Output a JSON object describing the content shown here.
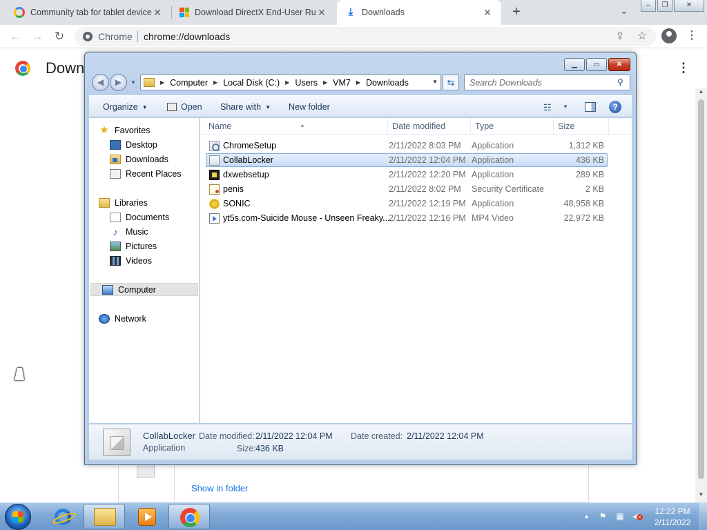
{
  "browser": {
    "tabs": [
      {
        "title": "Community tab for tablet device",
        "icon": "google-icon",
        "active": false
      },
      {
        "title": "Download DirectX End-User Runti",
        "icon": "microsoft-icon",
        "active": false
      },
      {
        "title": "Downloads",
        "icon": "download-icon",
        "active": true
      }
    ],
    "close_glyph": "✕",
    "new_tab_glyph": "+",
    "omnibox": {
      "site_label": "Chrome",
      "url": "chrome://downloads"
    },
    "page": {
      "title": "Down",
      "card_link": "Show in folder"
    }
  },
  "explorer": {
    "address": {
      "crumbs": [
        "Computer",
        "Local Disk (C:)",
        "Users",
        "VM7",
        "Downloads"
      ]
    },
    "search_placeholder": "Search Downloads",
    "commands": {
      "organize": "Organize",
      "open": "Open",
      "share_with": "Share with",
      "new_folder": "New folder"
    },
    "nav": {
      "favorites": "Favorites",
      "desktop": "Desktop",
      "downloads": "Downloads",
      "recent_places": "Recent Places",
      "libraries": "Libraries",
      "documents": "Documents",
      "music": "Music",
      "pictures": "Pictures",
      "videos": "Videos",
      "computer": "Computer",
      "network": "Network"
    },
    "columns": {
      "name": "Name",
      "date_modified": "Date modified",
      "type": "Type",
      "size": "Size"
    },
    "files": [
      {
        "name": "ChromeSetup",
        "date": "2/11/2022 8:03 PM",
        "type": "Application",
        "size": "1,312 KB",
        "icon": "setup-icon"
      },
      {
        "name": "CollabLocker",
        "date": "2/11/2022 12:04 PM",
        "type": "Application",
        "size": "436 KB",
        "icon": "application-icon",
        "selected": true
      },
      {
        "name": "dxwebsetup",
        "date": "2/11/2022 12:20 PM",
        "type": "Application",
        "size": "289 KB",
        "icon": "directx-icon"
      },
      {
        "name": "penis",
        "date": "2/11/2022 8:02 PM",
        "type": "Security Certificate",
        "size": "2 KB",
        "icon": "certificate-icon"
      },
      {
        "name": "SONIC",
        "date": "2/11/2022 12:19 PM",
        "type": "Application",
        "size": "48,958 KB",
        "icon": "sonic-icon"
      },
      {
        "name": "yt5s.com-Suicide Mouse - Unseen Freaky...",
        "date": "2/11/2022 12:16 PM",
        "type": "MP4 Video",
        "size": "22,972 KB",
        "icon": "video-file-icon"
      }
    ],
    "details": {
      "name": "CollabLocker",
      "type": "Application",
      "date_modified_label": "Date modified:",
      "date_modified": "2/11/2022 12:04 PM",
      "date_created_label": "Date created:",
      "date_created": "2/11/2022 12:04 PM",
      "size_label": "Size:",
      "size": "436 KB"
    }
  },
  "taskbar": {
    "clock_time": "12:22 PM",
    "clock_date": "2/11/2022"
  },
  "colors": {
    "chrome_accent": "#1a73e8",
    "explorer_frame": "#b7cde8",
    "selection": "#c9ddf6",
    "taskbar": "#7fa8d5"
  }
}
